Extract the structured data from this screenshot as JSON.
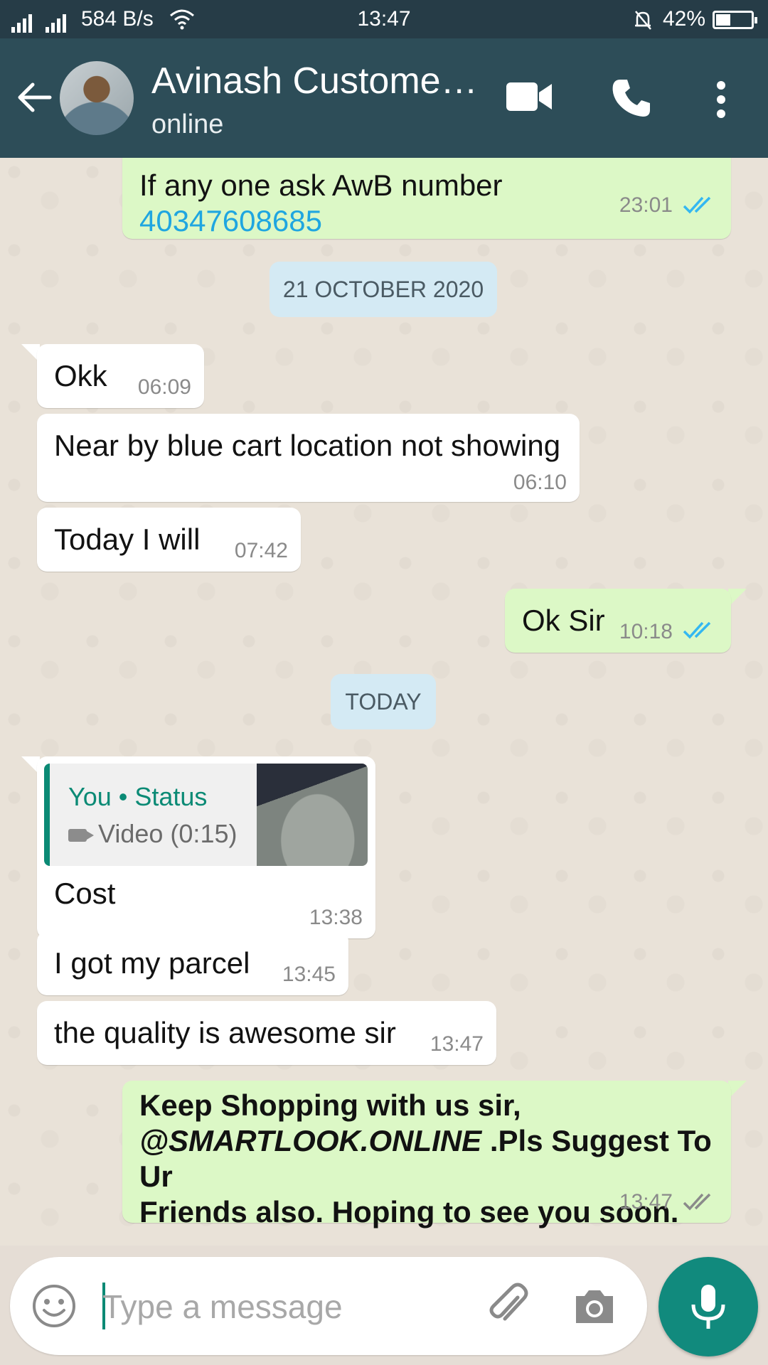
{
  "status_bar": {
    "network_speed": "584 B/s",
    "time": "13:47",
    "battery_percent": "42%",
    "battery_level": 0.42
  },
  "header": {
    "contact_name": "Avinash Custome…",
    "status": "online",
    "icons": [
      "back-arrow-icon",
      "video-call-icon",
      "phone-icon",
      "more-vertical-icon"
    ]
  },
  "messages": [
    {
      "direction": "out",
      "text": "If any one ask AwB number",
      "link": "40347608685",
      "time": "23:01",
      "read": true
    },
    {
      "type": "date",
      "text": "21 OCTOBER 2020"
    },
    {
      "direction": "in",
      "text": "Okk",
      "time": "06:09"
    },
    {
      "direction": "in",
      "text": "Near by blue cart location not showing",
      "time": "06:10"
    },
    {
      "direction": "in",
      "text": "Today I will",
      "time": "07:42"
    },
    {
      "direction": "out",
      "text": "Ok Sir",
      "time": "10:18",
      "read": true
    },
    {
      "type": "date",
      "text": "TODAY"
    },
    {
      "direction": "in",
      "quote": {
        "author": "You • Status",
        "media": "Video (0:15)"
      },
      "text": "Cost",
      "time": "13:38"
    },
    {
      "direction": "in",
      "text": "I got my parcel",
      "time": "13:45"
    },
    {
      "direction": "in",
      "text": "the quality is awesome sir",
      "time": "13:47"
    },
    {
      "direction": "out",
      "text_line1": "Keep Shopping with us sir,",
      "text_line2_italic": "@SMARTLOOK.ONLINE",
      "text_line2_rest": " .Pls Suggest To Ur",
      "text_line3": "Friends also. Hoping to see you soon.",
      "time": "13:47",
      "read": false
    }
  ],
  "composer": {
    "placeholder": "Type a message",
    "value": ""
  },
  "colors": {
    "header": "#2d4d58",
    "outgoing_bubble": "#dcf8c6",
    "incoming_bubble": "#ffffff",
    "read_ticks": "#34b7f1",
    "accent": "#118a7d"
  }
}
